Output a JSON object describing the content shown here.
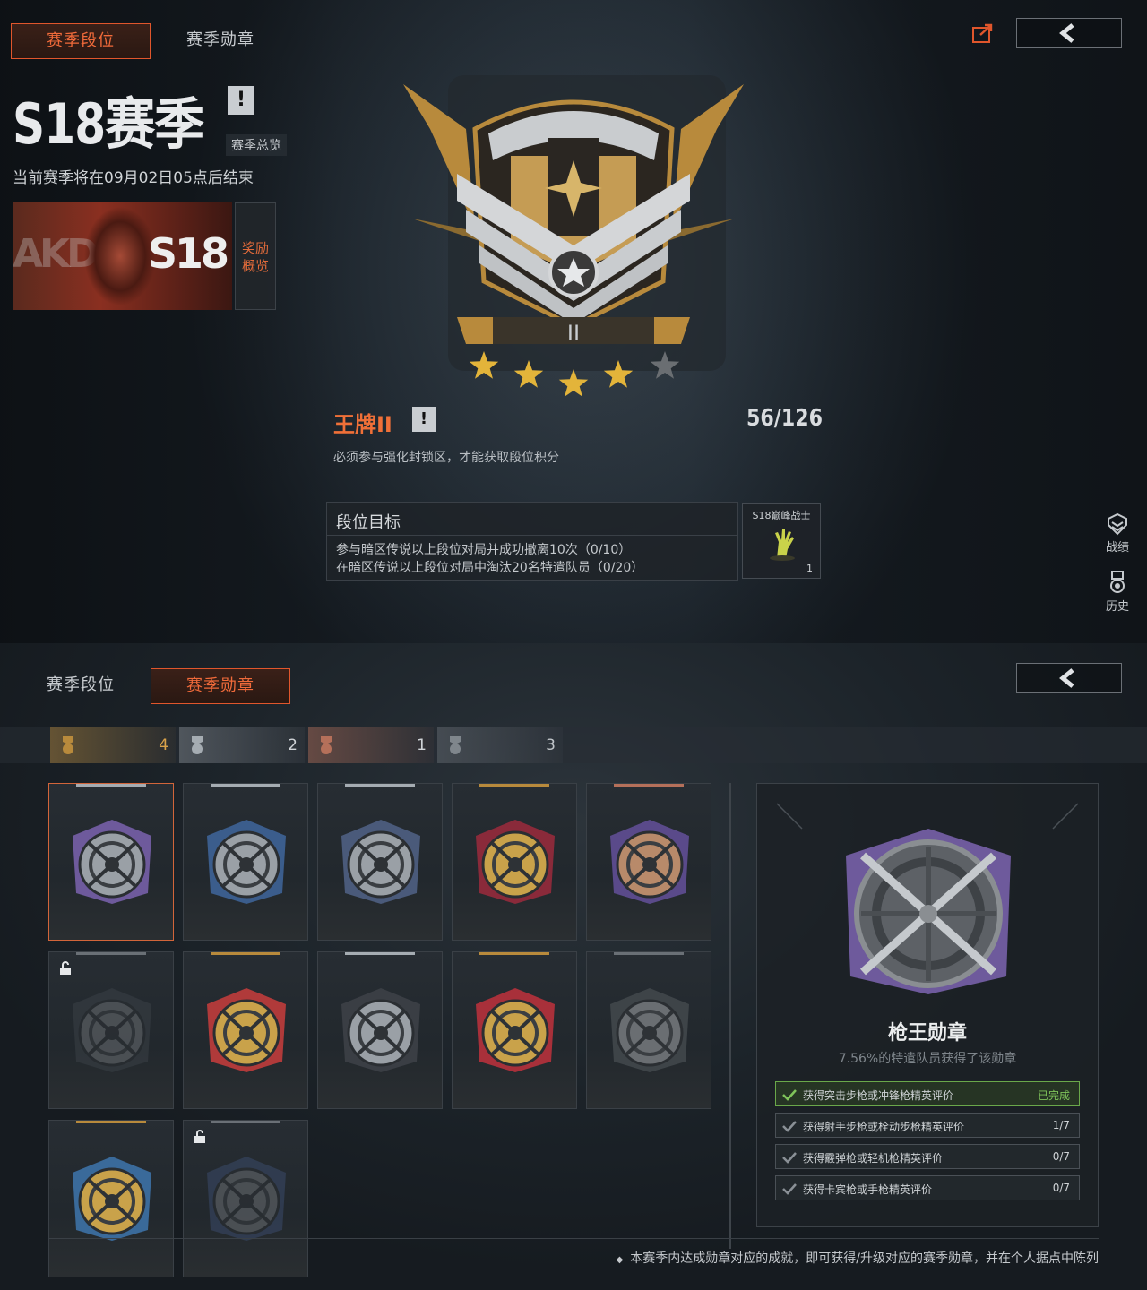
{
  "rank_screen": {
    "tabs": [
      {
        "label": "赛季段位",
        "active": true
      },
      {
        "label": "赛季勋章",
        "active": false
      }
    ],
    "share_icon": "share-icon",
    "back_icon": "chevron-left-icon",
    "season_title": "S18赛季",
    "warn_mark": "!",
    "season_overview_link": "赛季总览",
    "season_end_text": "当前赛季将在09月02日05点后结束",
    "reward_banner": {
      "brand_text": "AKD",
      "season_tag": "S18",
      "label": "奖励概览"
    },
    "rank_numeral": "II",
    "stars_filled": 4,
    "stars_total": 5,
    "rank_name": "王牌II",
    "rank_points": "56/126",
    "rank_hint": "必须参与强化封锁区，才能获取段位积分",
    "goal": {
      "title": "段位目标",
      "lines": [
        "参与暗区传说以上段位对局并成功撤离10次（0/10）",
        "在暗区传说以上段位对局中淘汰20名特遣队员（0/20）"
      ],
      "reward_title": "S18巅峰战士",
      "reward_count": "1"
    },
    "side_buttons": [
      {
        "label": "战绩",
        "icon": "combat-record-icon"
      },
      {
        "label": "历史",
        "icon": "history-medal-icon"
      }
    ]
  },
  "medal_screen": {
    "tabs": [
      {
        "label": "赛季段位",
        "active": false
      },
      {
        "label": "赛季勋章",
        "active": true
      }
    ],
    "back_icon": "chevron-left-icon",
    "tier_counts": [
      {
        "tier": "gold",
        "count": "4",
        "color": "#b88a3c"
      },
      {
        "tier": "silver",
        "count": "2",
        "color": "#a5acb2"
      },
      {
        "tier": "bronze",
        "count": "1",
        "color": "#b5705a"
      },
      {
        "tier": "grey",
        "count": "3",
        "color": "#7f868c"
      }
    ],
    "medals": [
      {
        "icon": "crossed-rifles-medal-icon",
        "tier": "silver",
        "ribbon": "#6e5a9c",
        "locked": false,
        "selected": true
      },
      {
        "icon": "eagle-medal-icon",
        "tier": "silver",
        "ribbon": "#3b5d8c",
        "locked": false,
        "selected": false
      },
      {
        "icon": "cross-target-medal-icon",
        "tier": "silver",
        "ribbon": "#4a5a7a",
        "locked": false,
        "selected": false
      },
      {
        "icon": "gold-cross-medal-icon",
        "tier": "gold",
        "ribbon": "#8a2a3a",
        "locked": false,
        "selected": false
      },
      {
        "icon": "helmet-medal-icon",
        "tier": "bronze",
        "ribbon": "#5a4a8a",
        "locked": false,
        "selected": false
      },
      {
        "icon": "silhouette-medal-icon",
        "tier": "grey",
        "ribbon": "#3a4046",
        "locked": true,
        "selected": false
      },
      {
        "icon": "lion-medal-icon",
        "tier": "gold",
        "ribbon": "#b03a3a",
        "locked": false,
        "selected": false
      },
      {
        "icon": "skull-helmet-medal-icon",
        "tier": "silver",
        "ribbon": "#3a3e44",
        "locked": false,
        "selected": false
      },
      {
        "icon": "gold-star-medal-icon",
        "tier": "gold",
        "ribbon": "#a8303a",
        "locked": false,
        "selected": false
      },
      {
        "icon": "hammer-medal-icon",
        "tier": "grey",
        "ribbon": "#3e4448",
        "locked": false,
        "selected": false
      },
      {
        "icon": "tank-medal-icon",
        "tier": "gold",
        "ribbon": "#3a6a9a",
        "locked": false,
        "selected": false
      },
      {
        "icon": "shield-medal-icon",
        "tier": "grey",
        "ribbon": "#3a4a6a",
        "locked": true,
        "selected": false
      }
    ],
    "detail": {
      "icon": "crossed-rifles-medal-icon",
      "name": "枪王勋章",
      "owned_percent": "7.56%的特遣队员获得了该勋章",
      "criteria": [
        {
          "label": "获得突击步枪或冲锋枪精英评价",
          "value": "已完成",
          "done": true
        },
        {
          "label": "获得射手步枪或栓动步枪精英评价",
          "value": "1/7",
          "done": false
        },
        {
          "label": "获得霰弹枪或轻机枪精英评价",
          "value": "0/7",
          "done": false
        },
        {
          "label": "获得卡宾枪或手枪精英评价",
          "value": "0/7",
          "done": false
        }
      ]
    },
    "footnote": "本赛季内达成勋章对应的成就，即可获得/升级对应的赛季勋章，并在个人据点中陈列"
  }
}
